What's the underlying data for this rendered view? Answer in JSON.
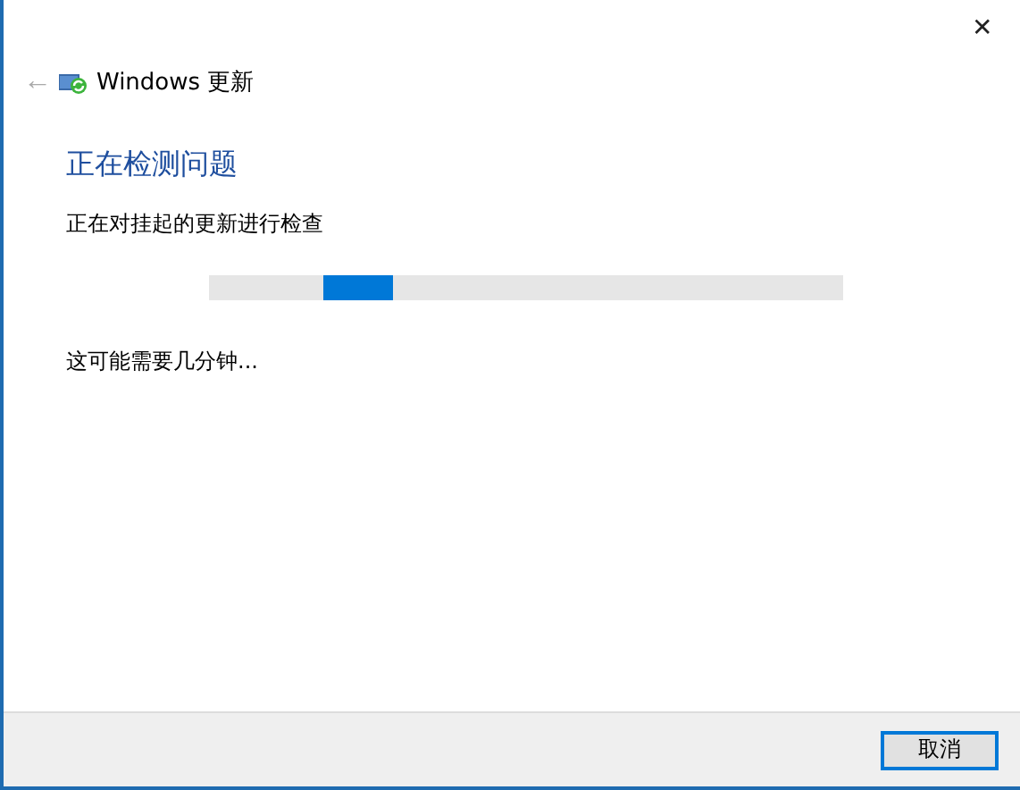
{
  "window": {
    "close_symbol": "✕",
    "back_symbol": "←",
    "title": "Windows 更新"
  },
  "heading": "正在检测问题",
  "status": "正在对挂起的更新进行检查",
  "progress": {
    "kind": "marquee"
  },
  "note": "这可能需要几分钟...",
  "buttons": [
    {
      "label": "取消",
      "focused": true
    }
  ]
}
